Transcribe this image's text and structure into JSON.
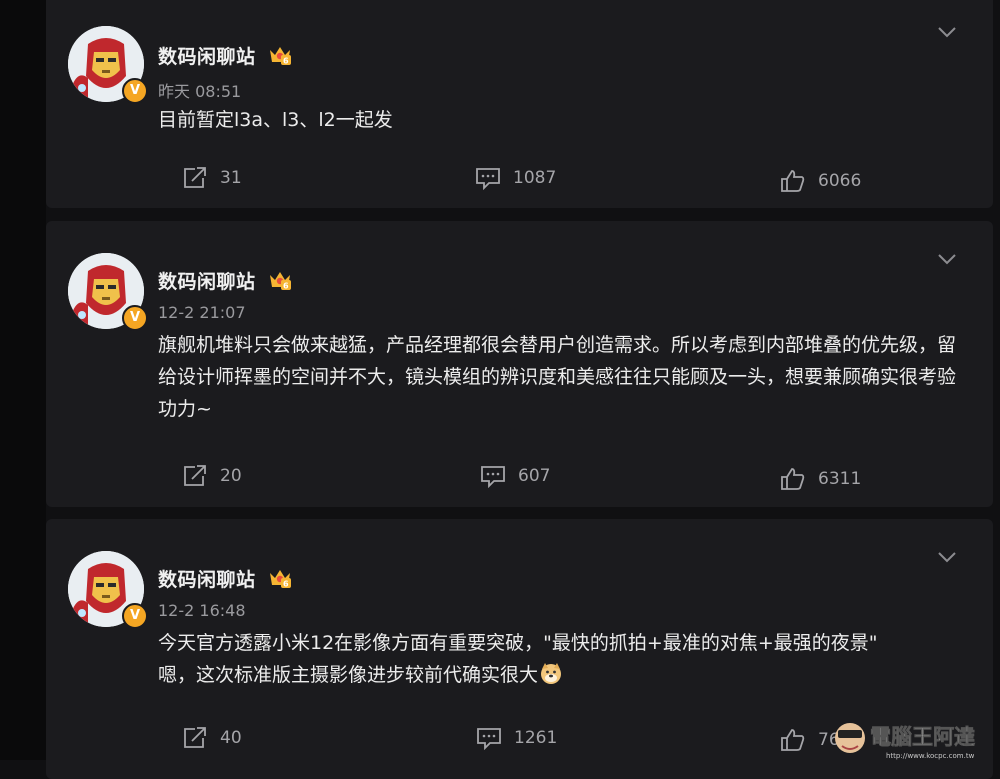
{
  "posts": [
    {
      "author": "数码闲聊站",
      "time": "昨天 08:51",
      "text": "目前暂定l3a、l3、l2一起发",
      "reposts": "31",
      "comments": "1087",
      "likes": "6066"
    },
    {
      "author": "数码闲聊站",
      "time": "12-2 21:07",
      "text": "旗舰机堆料只会做来越猛，产品经理都很会替用户创造需求。所以考虑到内部堆叠的优先级，留给设计师挥墨的空间并不大，镜头模组的辨识度和美感往往只能顾及一头，想要兼顾确实很考验功力~",
      "reposts": "20",
      "comments": "607",
      "likes": "6311"
    },
    {
      "author": "数码闲聊站",
      "time": "12-2 16:48",
      "text_line1": "今天官方透露小米12在影像方面有重要突破，\"最快的抓拍+最准的对焦+最强的夜景\"",
      "text_line2": "嗯，这次标准版主摄影像进步较前代确实很大",
      "reposts": "40",
      "comments": "1261",
      "likes": "76"
    }
  ],
  "icons": {
    "verified_badge": "V",
    "crown": "vip-crown-icon",
    "dropdown": "chevron-down-icon",
    "repost": "share-arrow-icon",
    "comment": "comment-bubble-icon",
    "like": "thumbs-up-icon",
    "emoji": "doge-emoji-icon"
  },
  "watermark": {
    "site_name": "電腦王阿達",
    "url": "http://www.kocpc.com.tw"
  },
  "colors": {
    "background": "#101012",
    "card": "#1b1b1e",
    "text": "#ececec",
    "muted": "#9a9a9e",
    "badge": "#f5a623"
  }
}
